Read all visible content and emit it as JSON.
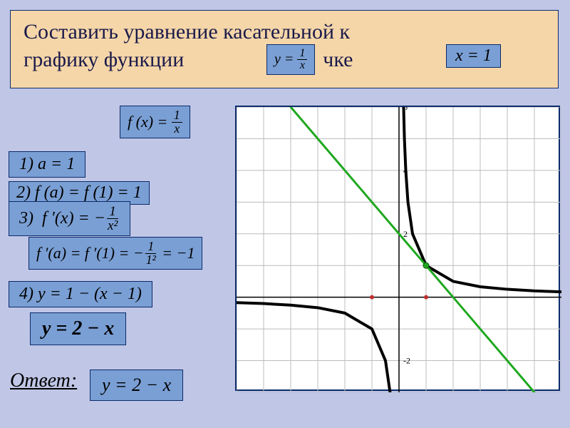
{
  "header": {
    "line1": "Составить уравнение касательной к",
    "line2_a": "графику функции",
    "line2_b": "чке"
  },
  "header_formula": {
    "lhs": "y =",
    "num": "1",
    "den": "x"
  },
  "header_point": "x = 1",
  "below_formula": {
    "lhs": "f (x) =",
    "num": "1",
    "den": "x"
  },
  "step1": "1)   a = 1",
  "step2": "2)   f (a) =  f (1) = 1",
  "step3": {
    "label": "3)",
    "lhs": "f ′(x) = −",
    "num": "1",
    "den": "x²"
  },
  "step3b": {
    "lhs": "f ′(a) =  f ′(1) = −",
    "num": "1",
    "den": "1²",
    "rhs": "= −1"
  },
  "step4": "4)   y = 1 − (x − 1)",
  "result": "y = 2 − x",
  "answer_label": "Ответ:",
  "answer": "y = 2 − x",
  "chart_data": {
    "type": "line",
    "title": "",
    "xlabel": "",
    "ylabel": "",
    "xlim": [
      -6,
      6
    ],
    "ylim": [
      -3,
      6
    ],
    "grid": true,
    "series": [
      {
        "name": "y = 1/x (branch x>0)",
        "color": "#000000",
        "x": [
          0.17,
          0.2,
          0.25,
          0.33,
          0.5,
          1,
          2,
          3,
          4,
          5,
          6
        ],
        "y": [
          6,
          5,
          4,
          3,
          2,
          1,
          0.5,
          0.33,
          0.25,
          0.2,
          0.17
        ]
      },
      {
        "name": "y = 1/x (branch x<0)",
        "color": "#000000",
        "x": [
          -6,
          -5,
          -4,
          -3,
          -2,
          -1,
          -0.5,
          -0.33
        ],
        "y": [
          -0.17,
          -0.2,
          -0.25,
          -0.33,
          -0.5,
          -1,
          -2,
          -3
        ]
      },
      {
        "name": "y = 2 − x (tangent)",
        "color": "#1fa81f",
        "x": [
          -4,
          5
        ],
        "y": [
          6,
          -3
        ]
      }
    ],
    "tangent_point": {
      "x": 1,
      "y": 1
    }
  }
}
